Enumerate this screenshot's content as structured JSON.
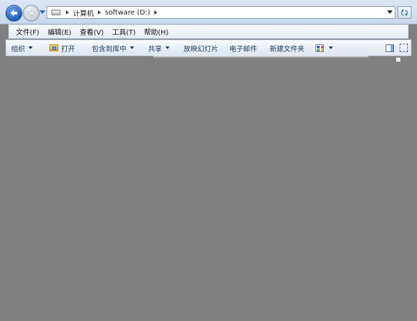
{
  "address": {
    "crumbs": [
      "计算机",
      "software (D:)"
    ]
  },
  "menu": {
    "items": [
      "文件(F)",
      "编辑(E)",
      "查看(V)",
      "工具(T)",
      "帮助(H)"
    ]
  },
  "toolbar": {
    "organize": "组织",
    "open": "打开",
    "include_library": "包含到库中",
    "share": "共享",
    "slideshow": "放映幻灯片",
    "email": "电子邮件",
    "new_folder": "新建文件夹"
  },
  "colors": {
    "content_background": "#808080",
    "accent": "#1e5bb5"
  }
}
